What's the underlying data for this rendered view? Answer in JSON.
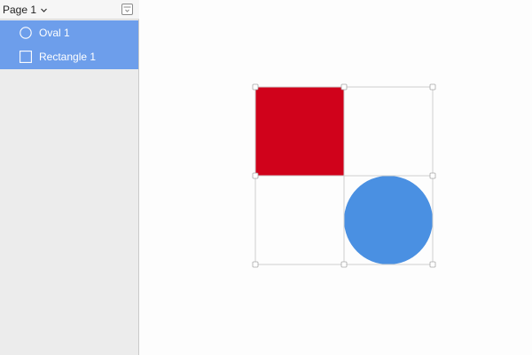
{
  "page_selector": {
    "label": "Page 1"
  },
  "layers": [
    {
      "label": "Oval 1",
      "icon": "oval-icon"
    },
    {
      "label": "Rectangle 1",
      "icon": "rectangle-icon"
    }
  ],
  "canvas": {
    "rectangle": {
      "name": "Rectangle 1",
      "fill": "#d0021b"
    },
    "oval": {
      "name": "Oval 1",
      "fill": "#4a90e2"
    }
  },
  "colors": {
    "sidebar_bg": "#ececec",
    "selection_bg": "#6d9eeb",
    "selection_outline": "#c9c9c9",
    "handle_fill": "#ffffff",
    "handle_stroke": "#a8a8a8"
  }
}
